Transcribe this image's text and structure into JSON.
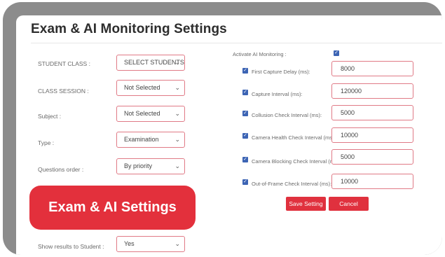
{
  "page": {
    "title": "Exam & AI Monitoring Settings"
  },
  "left_form": [
    {
      "label": "STUDENT CLASS :",
      "value": "SELECT STUDENTS"
    },
    {
      "label": "CLASS SESSION :",
      "value": "Not Selected"
    },
    {
      "label": "Subject :",
      "value": "Not Selected"
    },
    {
      "label": "Type :",
      "value": "Examination"
    },
    {
      "label": "Questions order :",
      "value": "By priority"
    },
    {
      "label": "Show results to Student :",
      "value": "Yes"
    }
  ],
  "right_form": {
    "activate_label": "Activate AI Monitoring :",
    "fields": [
      {
        "label": "First Capture Delay (ms):",
        "value": "8000"
      },
      {
        "label": "Capture Interval (ms):",
        "value": "120000"
      },
      {
        "label": "Collusion Check Interval (ms):",
        "value": "5000"
      },
      {
        "label": "Camera Health Check Interval (ms):",
        "value": "10000"
      },
      {
        "label": "Camera Blocking Check Interval (ms):",
        "value": "5000"
      },
      {
        "label": "Out-of-Frame Check Interval (ms):",
        "value": "10000"
      }
    ]
  },
  "buttons": {
    "save": "Save Setting",
    "cancel": "Cancel"
  },
  "overlay_badge": "Exam & AI Settings",
  "icons": {
    "dropdown": "chevron-down-icon",
    "checkbox": "checkbox-checked-icon"
  },
  "colors": {
    "accent": "#e0313e",
    "frame": "#8c8c8c",
    "checkbox": "#3c64b4"
  }
}
